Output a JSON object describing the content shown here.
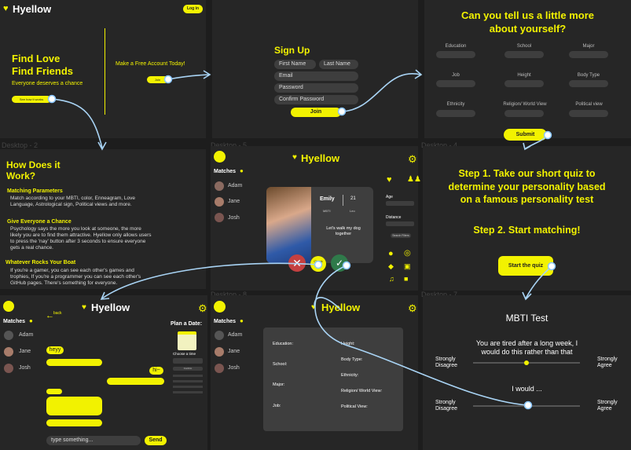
{
  "desktop1": {
    "logo": "Hyellow",
    "login": "Log in",
    "hero_line1": "Find Love",
    "hero_line2": "Find Friends",
    "subtitle": "Everyone deserves a chance",
    "cta_small": "See how it works",
    "make_account": "Make a Free Account Today!",
    "join_small": "Join"
  },
  "signup": {
    "title": "Sign Up",
    "first_name": "First Name",
    "last_name": "Last Name",
    "email": "Email",
    "password": "Password",
    "confirm_password": "Confirm Password",
    "join": "Join"
  },
  "profile_form": {
    "title_line1": "Can you tell us a little more",
    "title_line2": "about yourself?",
    "fields": [
      "Education",
      "School",
      "Major",
      "Job",
      "Height",
      "Body Type",
      "Ethnicity",
      "Religion/ World View",
      "Political view"
    ],
    "submit": "Submit"
  },
  "frame_labels": {
    "d2": "Desktop - 2",
    "d5": "Desktop - 5",
    "d4": "Desktop - 4",
    "d8": "Desktop - 8",
    "d7": "Desktop - 7"
  },
  "how": {
    "title_line1": "How Does it",
    "title_line2": "Work?",
    "s1_title": "Matching Parameters",
    "s1_text1": "Match according to your MBTI, color, Enneagram, Love",
    "s1_text2": "Language, Astrological sign, Political views and more.",
    "s2_title": "Give Everyone a Chance",
    "s2_text1": "Psychology says the more you look at someone, the more",
    "s2_text2": "likely you are to find them attractive. Hyellow only allows users",
    "s2_text3": "to press the 'nay' button after 3 seconds to ensure everyone",
    "s2_text4": "gets a real chance.",
    "s3_title": "Whatever Rocks Your Boat",
    "s3_text1": "If you're a gamer, you can see each other's games and",
    "s3_text2": "trophies, If you're a programmer you can see each other's",
    "s3_text3": "GitHub pages. There's something for everyone."
  },
  "matches_panel": {
    "title": "Matches",
    "names": [
      "Adam",
      "Jane",
      "Josh"
    ]
  },
  "card": {
    "logo": "Hyellow",
    "name": "Emily",
    "age": "21",
    "mbti_label": "MBTI",
    "mbti_value": "Leo",
    "bio_line1": "Let's walk my dog",
    "bio_line2": "together",
    "check_label": "Check Later",
    "age_label": "Age",
    "distance_label": "Distance",
    "filter_button": "Search Filters"
  },
  "quiz": {
    "step1_line1": "Step 1. Take our short quiz to",
    "step1_line2": "determine your personality based",
    "step1_line3": "on a famous personality test",
    "step2": "Step 2. Start matching!",
    "start": "Start the quiz"
  },
  "chat": {
    "logo": "Hyellow",
    "back": "back",
    "msg1": "heyy",
    "msg2": "hi~",
    "input_placeholder": "type something...",
    "send": "Send",
    "plan_title": "Plan a Date:",
    "choose_time": "Choose a time",
    "confirm": "Confirm"
  },
  "details": {
    "logo": "Hyellow",
    "left_fields": [
      "Education:",
      "School:",
      "Major:",
      "Job:"
    ],
    "right_fields": [
      "Height:",
      "Body Type:",
      "Ethnicity:",
      "Religion/ World View:",
      "Political View:"
    ]
  },
  "mbti": {
    "title": "MBTI Test",
    "q1_line1": "You are tired after a long week, I",
    "q1_line2": "would do this rather than that",
    "strongly": "Strongly",
    "disagree": "Disagree",
    "agree": "Agree",
    "q2": "I would ...",
    "q1_value": 0.5,
    "q2_value": 0.5
  },
  "colors": {
    "accent": "#f2f200",
    "background": "#1d1d1d",
    "panel": "#262626",
    "connector": "#a9d4f5"
  }
}
